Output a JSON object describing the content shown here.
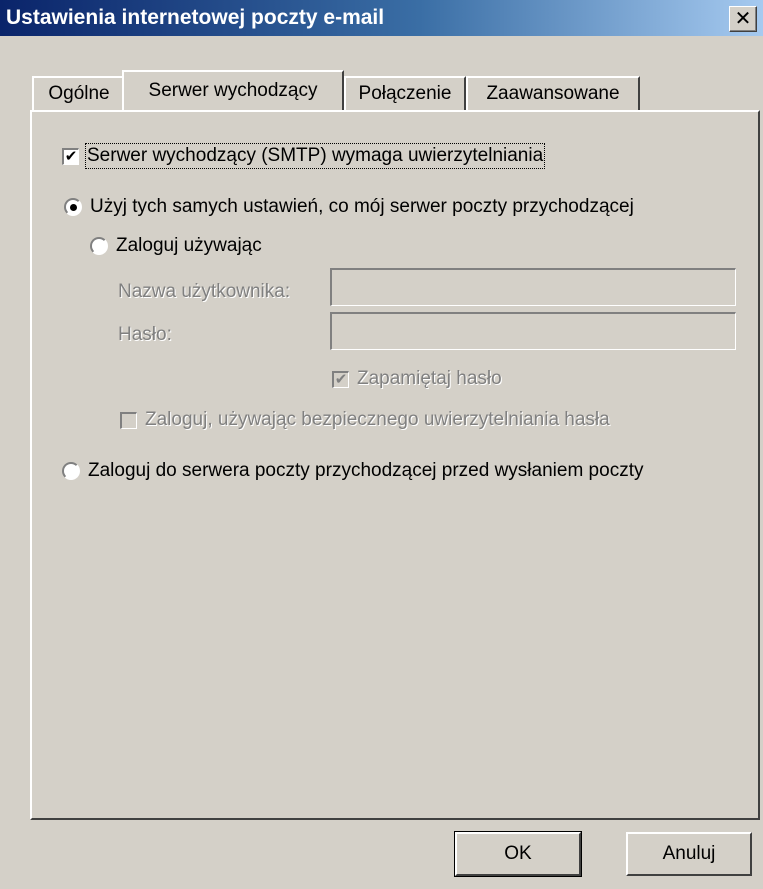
{
  "window": {
    "title": "Ustawienia internetowej poczty e-mail",
    "close_glyph": "✕"
  },
  "tabs": [
    {
      "label": "Ogólne",
      "active": false
    },
    {
      "label": "Serwer wychodzący",
      "active": true
    },
    {
      "label": "Połączenie",
      "active": false
    },
    {
      "label": "Zaawansowane",
      "active": false
    }
  ],
  "panel": {
    "smtp_auth": {
      "label": "Serwer wychodzący (SMTP) wymaga uwierzytelniania",
      "checked": true
    },
    "use_same_settings": {
      "label": "Użyj tych samych ustawień, co mój serwer poczty przychodzącej",
      "selected": true
    },
    "log_on_using": {
      "label": "Zaloguj używając",
      "selected": false
    },
    "username": {
      "label": "Nazwa użytkownika:",
      "value": ""
    },
    "password": {
      "label": "Hasło:",
      "value": ""
    },
    "remember_password": {
      "label": "Zapamiętaj hasło",
      "checked": true,
      "disabled": true
    },
    "spa": {
      "label": "Zaloguj, używając bezpiecznego uwierzytelniania hasła",
      "checked": false,
      "disabled": true
    },
    "log_on_incoming_first": {
      "label": "Zaloguj do serwera poczty przychodzącej przed wysłaniem poczty",
      "selected": false
    }
  },
  "buttons": {
    "ok": "OK",
    "cancel": "Anuluj"
  }
}
